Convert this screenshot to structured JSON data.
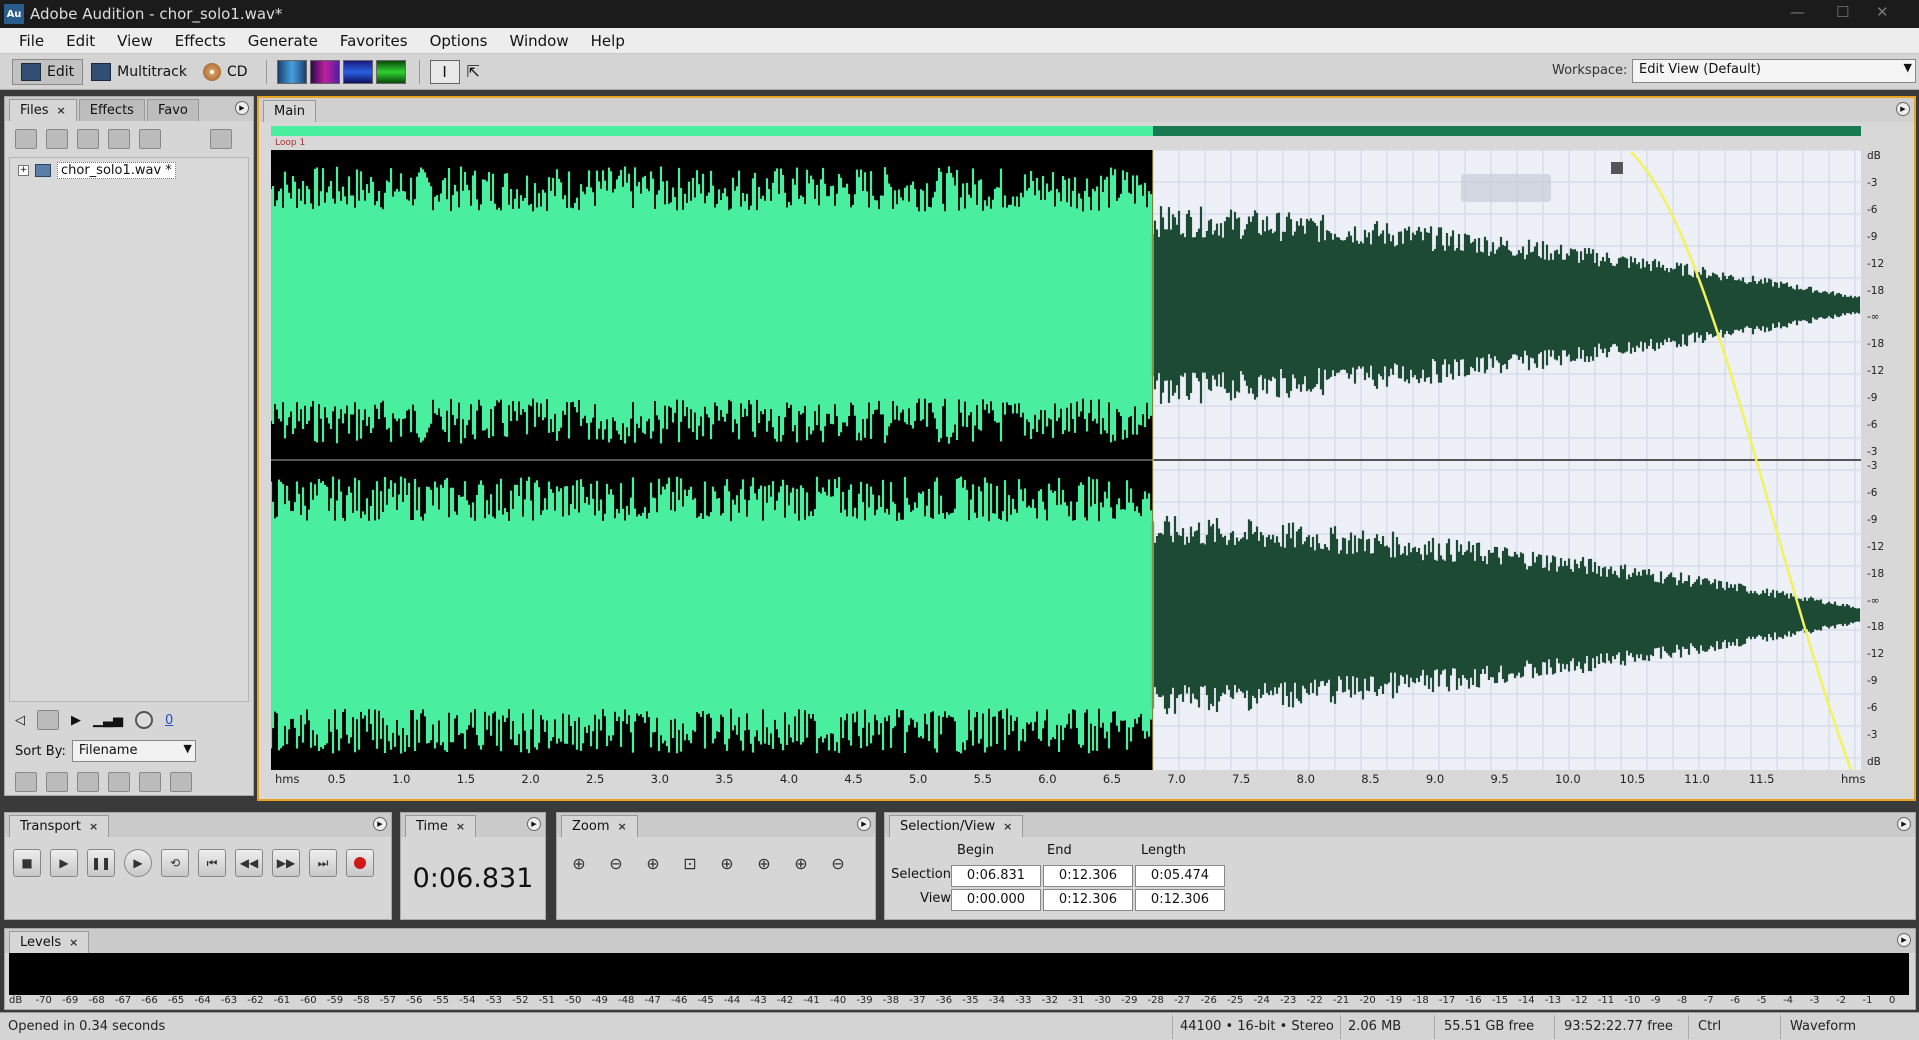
{
  "titlebar": {
    "app_icon": "Au",
    "title": "Adobe Audition - chor_solo1.wav*"
  },
  "menu": [
    "File",
    "Edit",
    "View",
    "Effects",
    "Generate",
    "Favorites",
    "Options",
    "Window",
    "Help"
  ],
  "toolbar": {
    "edit_label": "Edit",
    "multitrack_label": "Multitrack",
    "cd_label": "CD",
    "workspace_label": "Workspace:",
    "workspace_value": "Edit View (Default)"
  },
  "files_panel": {
    "tabs": [
      "Files",
      "Effects",
      "Favo"
    ],
    "file_name": "chor_solo1.wav *",
    "knob_value": "0",
    "sort_by_label": "Sort By:",
    "sort_by_value": "Filename"
  },
  "main_panel": {
    "tab": "Main",
    "loop_label": "Loop 1",
    "db_scale_top": [
      "dB",
      "-3",
      "-6",
      "-9",
      "-12",
      "-18",
      "-∞",
      "-18",
      "-12",
      "-9",
      "-6",
      "-3"
    ],
    "db_scale_bottom": [
      "-3",
      "-6",
      "-9",
      "-12",
      "-18",
      "-∞",
      "-18",
      "-12",
      "-9",
      "-6",
      "-3",
      "dB"
    ],
    "ruler_start": "hms",
    "ruler_end": "hms",
    "ruler_ticks": [
      "0.5",
      "1.0",
      "1.5",
      "2.0",
      "2.5",
      "3.0",
      "3.5",
      "4.0",
      "4.5",
      "5.0",
      "5.5",
      "6.0",
      "6.5",
      "7.0",
      "7.5",
      "8.0",
      "8.5",
      "9.0",
      "9.5",
      "10.0",
      "10.5",
      "11.0",
      "11.5"
    ],
    "selection_begin_fraction": 0.555,
    "colors": {
      "selected_bg": "#000000",
      "selected_wave": "#49ef9e",
      "unselected_bg": "#eef0f8",
      "unselected_wave": "#1c4a34",
      "fade_curve": "#f2f25a"
    }
  },
  "transport": {
    "tab": "Transport"
  },
  "time": {
    "tab": "Time",
    "display": "0:06.831"
  },
  "zoom": {
    "tab": "Zoom"
  },
  "selection_view": {
    "tab": "Selection/View",
    "headers": {
      "begin": "Begin",
      "end": "End",
      "length": "Length"
    },
    "selection": {
      "label": "Selection",
      "begin": "0:06.831",
      "end": "0:12.306",
      "length": "0:05.474"
    },
    "view": {
      "label": "View",
      "begin": "0:00.000",
      "end": "0:12.306",
      "length": "0:12.306"
    }
  },
  "levels": {
    "tab": "Levels",
    "scale": [
      "dB",
      "-70",
      "-69",
      "-68",
      "-67",
      "-66",
      "-65",
      "-64",
      "-63",
      "-62",
      "-61",
      "-60",
      "-59",
      "-58",
      "-57",
      "-56",
      "-55",
      "-54",
      "-53",
      "-52",
      "-51",
      "-50",
      "-49",
      "-48",
      "-47",
      "-46",
      "-45",
      "-44",
      "-43",
      "-42",
      "-41",
      "-40",
      "-39",
      "-38",
      "-37",
      "-36",
      "-35",
      "-34",
      "-33",
      "-32",
      "-31",
      "-30",
      "-29",
      "-28",
      "-27",
      "-26",
      "-25",
      "-24",
      "-23",
      "-22",
      "-21",
      "-20",
      "-19",
      "-18",
      "-17",
      "-16",
      "-15",
      "-14",
      "-13",
      "-12",
      "-11",
      "-10",
      "-9",
      "-8",
      "-7",
      "-6",
      "-5",
      "-4",
      "-3",
      "-2",
      "-1",
      "0"
    ]
  },
  "status": {
    "message": "Opened in 0.34 seconds",
    "format": "44100 • 16-bit • Stereo",
    "file_size": "2.06 MB",
    "disk_free": "55.51 GB free",
    "time_free": "93:52:22.77 free",
    "modifier": "Ctrl",
    "view_mode": "Waveform"
  }
}
